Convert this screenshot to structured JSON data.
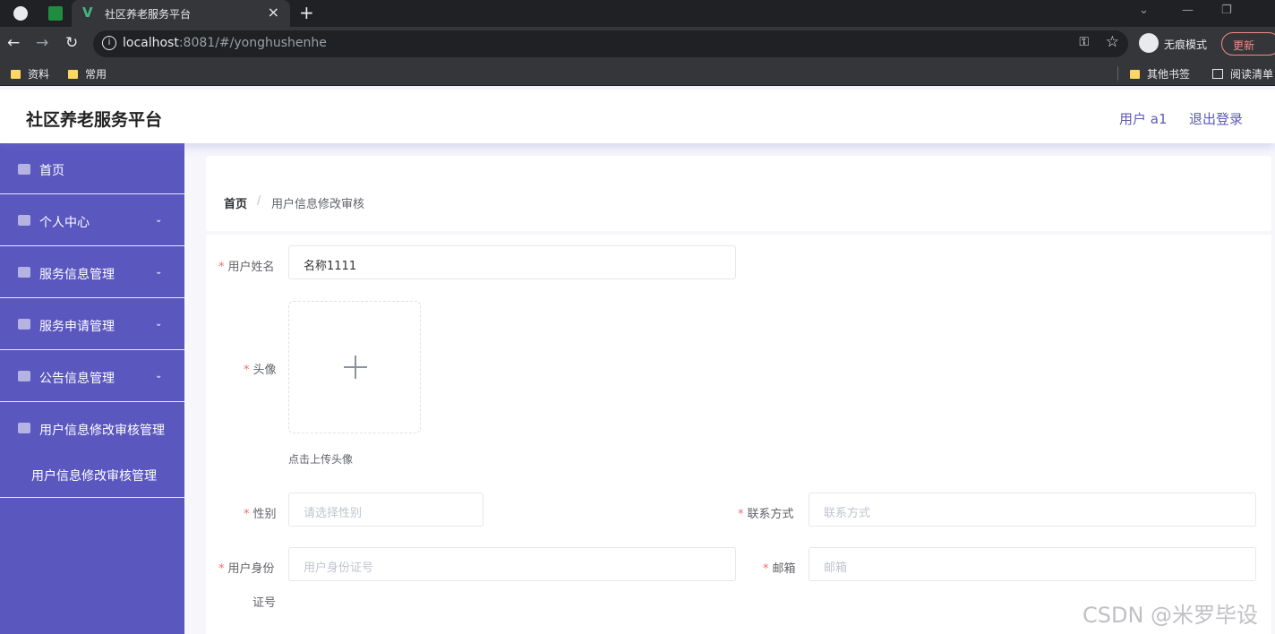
{
  "browser": {
    "tab_title": "社区养老服务平台",
    "url_host": "localhost",
    "url_rest": ":8081/#/yonghushenhe",
    "incognito_label": "无痕模式",
    "update_label": "更新",
    "bookmarks": [
      "资料",
      "常用"
    ],
    "other_bookmarks": "其他书签",
    "reading_list": "阅读清单"
  },
  "header": {
    "title": "社区养老服务平台",
    "user": "用户 a1",
    "logout": "退出登录"
  },
  "sidebar": {
    "items": [
      {
        "label": "首页",
        "icon": "home-icon"
      },
      {
        "label": "个人中心",
        "icon": "user-icon"
      },
      {
        "label": "服务信息管理",
        "icon": "list-icon"
      },
      {
        "label": "服务申请管理",
        "icon": "clipboard-icon"
      },
      {
        "label": "公告信息管理",
        "icon": "menu-icon"
      },
      {
        "label": "用户信息修改审核管理",
        "icon": "user-icon"
      }
    ],
    "sub_item": "用户信息修改审核管理"
  },
  "breadcrumb": {
    "home": "首页",
    "separator": "/",
    "current": "用户信息修改审核"
  },
  "form": {
    "username_label": "用户姓名",
    "username_value": "名称1111",
    "avatar_label": "头像",
    "avatar_hint": "点击上传头像",
    "gender_label": "性别",
    "gender_placeholder": "请选择性别",
    "contact_label": "联系方式",
    "contact_placeholder": "联系方式",
    "idcard_label_1": "用户身份",
    "idcard_label_2": "证号",
    "idcard_placeholder": "用户身份证号",
    "email_label": "邮箱",
    "email_placeholder": "邮箱"
  },
  "watermark": "CSDN @米罗毕设",
  "colors": {
    "sidebar": "#5a57bf",
    "accent": "#5d5ab5",
    "required": "#f56c6c"
  }
}
